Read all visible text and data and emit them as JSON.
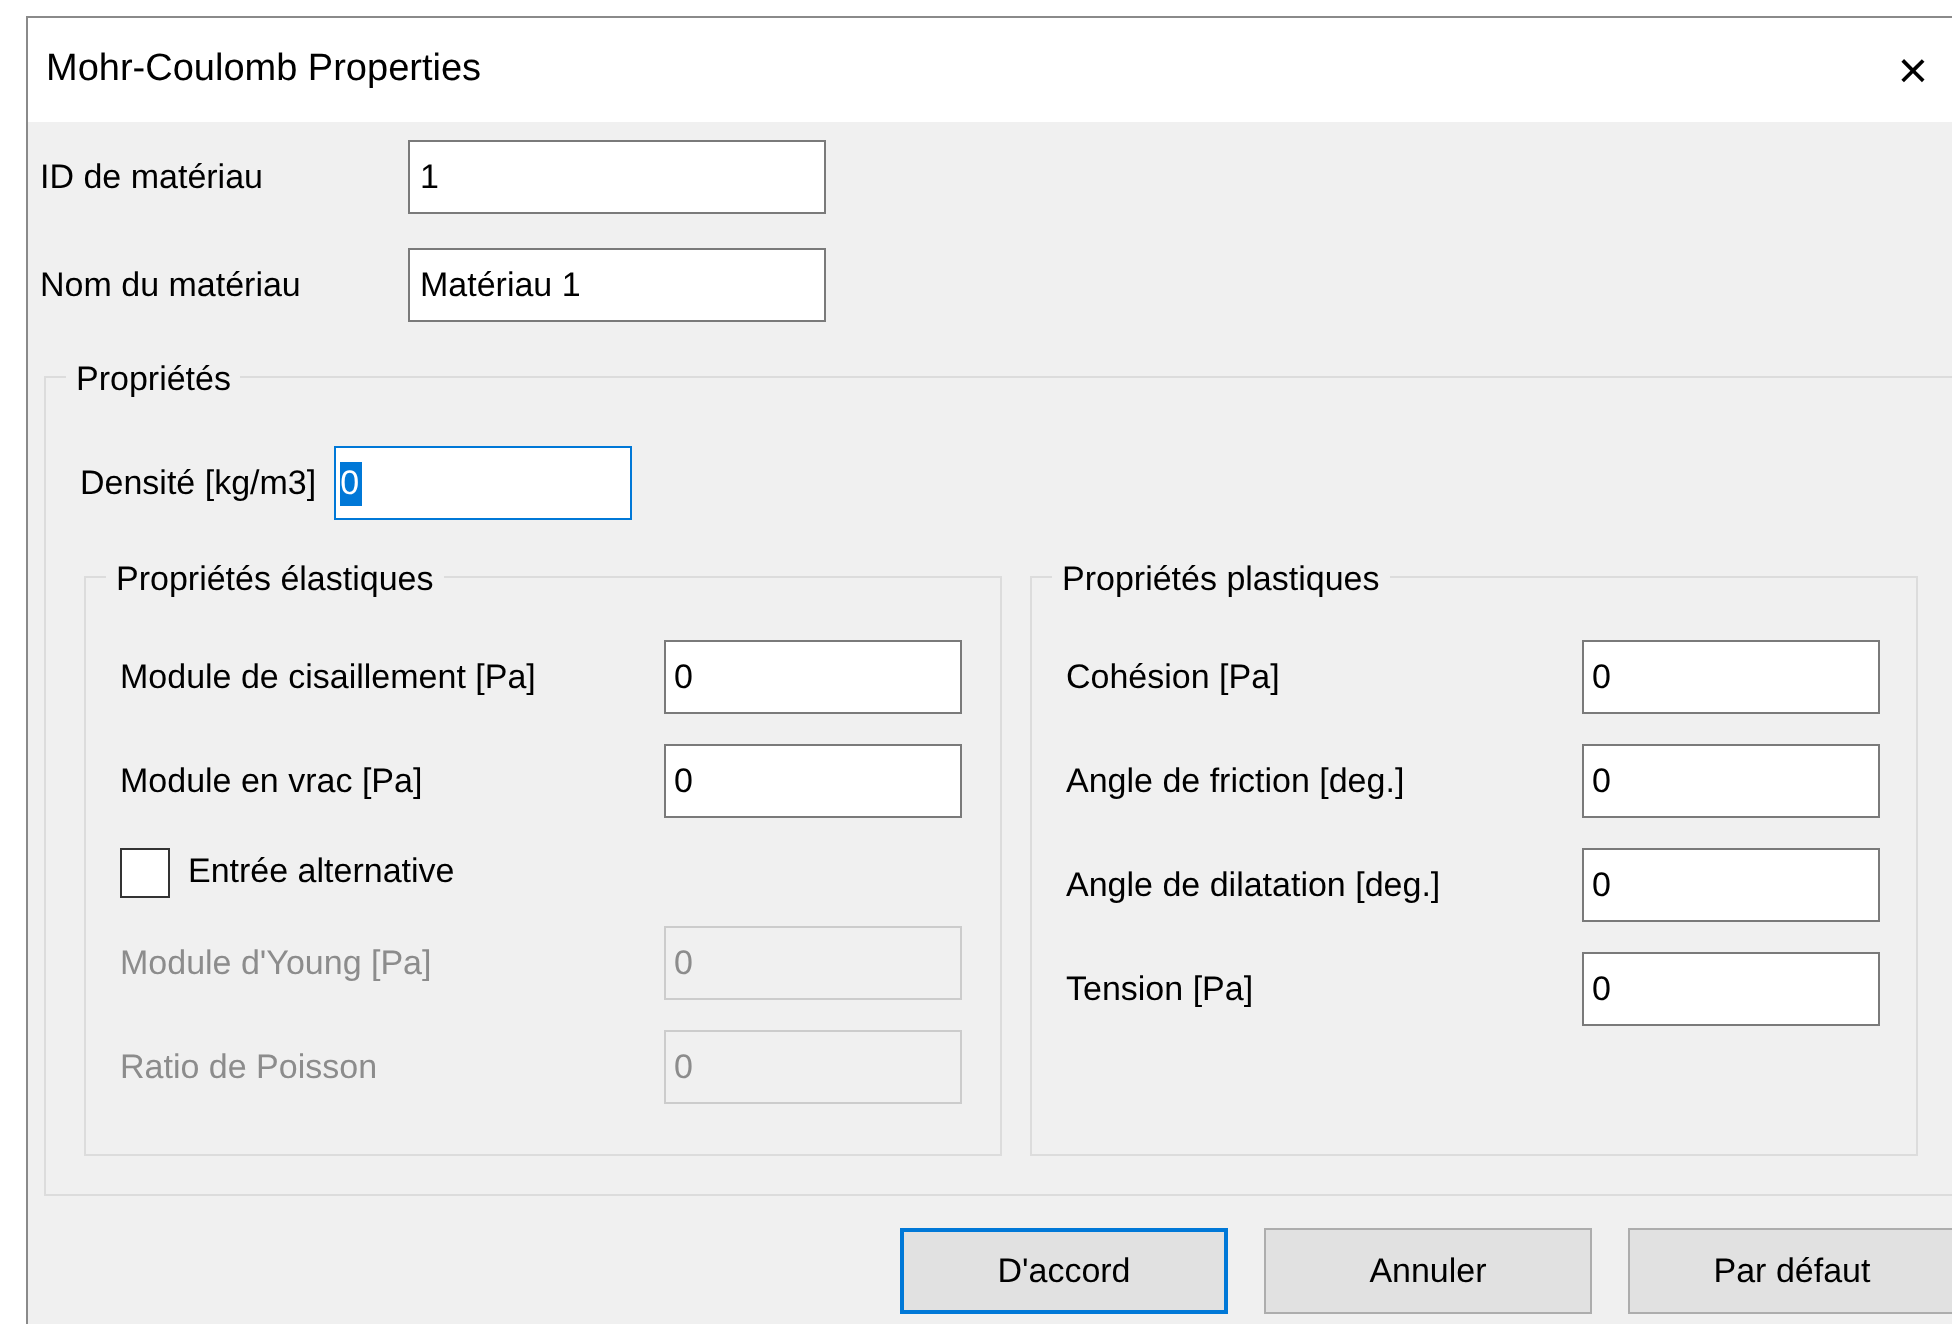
{
  "window": {
    "title": "Mohr-Coulomb Properties",
    "close": "×"
  },
  "header_fields": [
    {
      "label": "ID de matériau",
      "value": "1"
    },
    {
      "label": "Nom du matériau",
      "value": "Matériau 1"
    }
  ],
  "properties": {
    "title": "Propriétés",
    "density": {
      "label": "Densité [kg/m3]",
      "value": "0",
      "focused": true
    },
    "elastic": {
      "title": "Propriétés élastiques",
      "rows": [
        {
          "kind": "field",
          "label": "Module de cisaillement [Pa]",
          "value": "0",
          "disabled": false
        },
        {
          "kind": "field",
          "label": "Module en vrac [Pa]",
          "value": "0",
          "disabled": false
        },
        {
          "kind": "checkbox",
          "label": "Entrée alternative",
          "checked": false
        },
        {
          "kind": "field",
          "label": "Module d'Young [Pa]",
          "value": "0",
          "disabled": true
        },
        {
          "kind": "field",
          "label": "Ratio de Poisson",
          "value": "0",
          "disabled": true
        }
      ]
    },
    "plastic": {
      "title": "Propriétés plastiques",
      "rows": [
        {
          "kind": "field",
          "label": "Cohésion [Pa]",
          "value": "0",
          "disabled": false
        },
        {
          "kind": "field",
          "label": "Angle de friction [deg.]",
          "value": "0",
          "disabled": false
        },
        {
          "kind": "field",
          "label": "Angle de dilatation [deg.]",
          "value": "0",
          "disabled": false
        },
        {
          "kind": "field",
          "label": "Tension [Pa]",
          "value": "0",
          "disabled": false
        }
      ]
    }
  },
  "buttons": [
    {
      "label": "D'accord",
      "default": true
    },
    {
      "label": "Annuler",
      "default": false
    },
    {
      "label": "Par défaut",
      "default": false
    }
  ]
}
